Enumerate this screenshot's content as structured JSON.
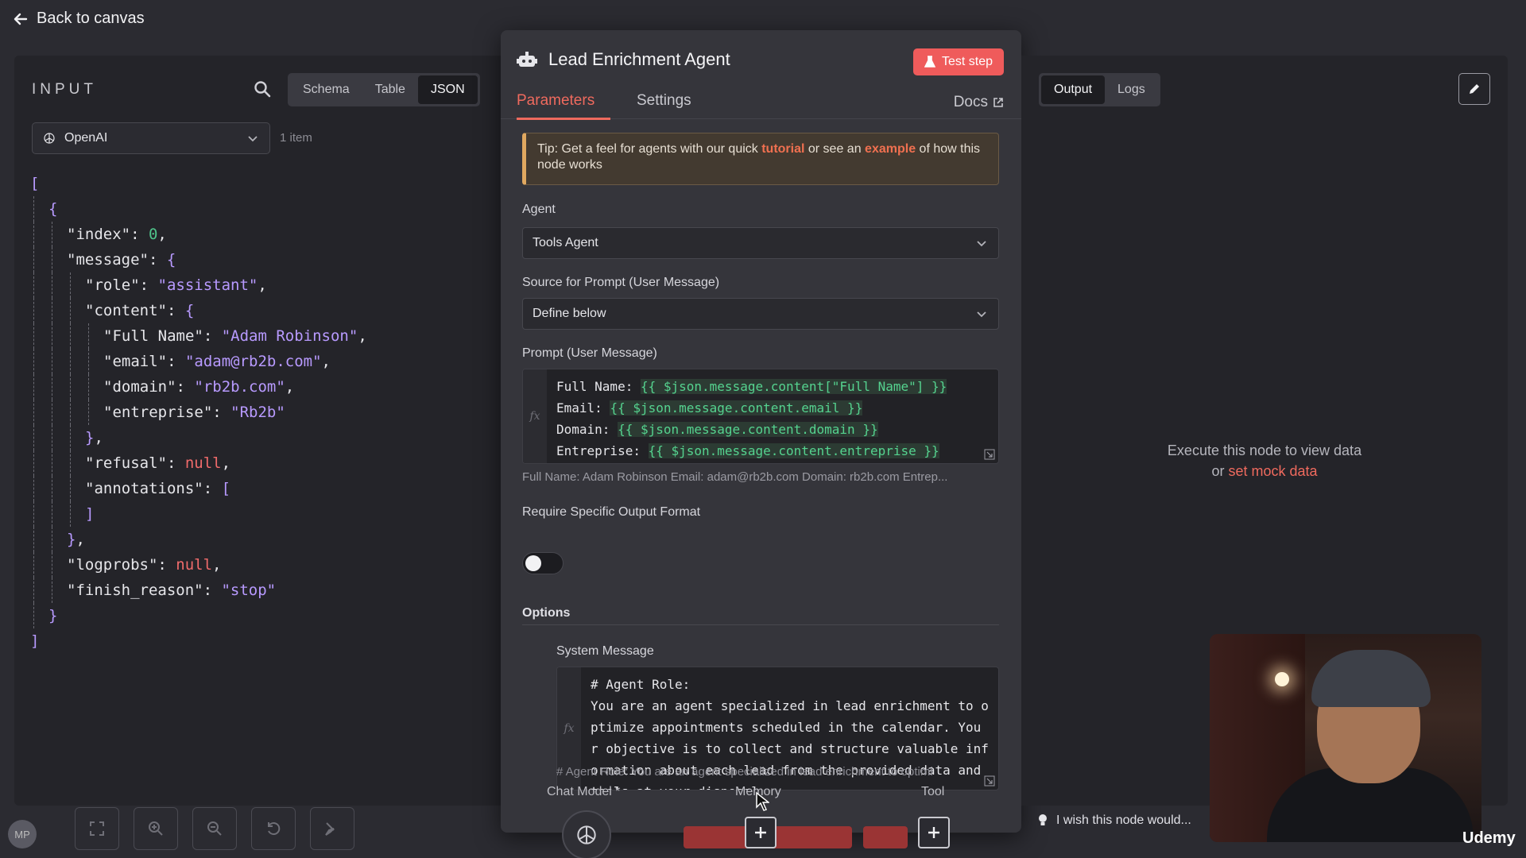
{
  "topbar": {
    "back_label": "Back to canvas"
  },
  "input": {
    "title": "INPUT",
    "views": [
      "Schema",
      "Table",
      "JSON"
    ],
    "active_view": "JSON",
    "source": "OpenAI",
    "item_count": "1 item"
  },
  "node": {
    "title": "Lead Enrichment Agent",
    "test_step": "Test step",
    "tabs": {
      "parameters": "Parameters",
      "settings": "Settings"
    },
    "docs": "Docs",
    "tip": {
      "prefix": "Tip: Get a feel for agents with our quick ",
      "tutorial": "tutorial",
      "middle": " or see an ",
      "example": "example",
      "suffix": " of how this node works"
    },
    "agent_label": "Agent",
    "agent_value": "Tools Agent",
    "source_label": "Source for Prompt (User Message)",
    "source_value": "Define below",
    "prompt_label": "Prompt (User Message)",
    "prompt_lines": [
      {
        "key": "Full Name: ",
        "expr": "{{ $json.message.content[\"Full Name\"] }}"
      },
      {
        "key": "Email: ",
        "expr": "{{ $json.message.content.email }}"
      },
      {
        "key": "Domain: ",
        "expr": "{{ $json.message.content.domain }}"
      },
      {
        "key": "Entreprise: ",
        "expr": "{{ $json.message.content.entreprise }}"
      }
    ],
    "prompt_preview": "Full Name: Adam Robinson Email: adam@rb2b.com Domain: rb2b.com Entrep...",
    "output_format_label": "Require Specific Output Format",
    "options_title": "Options",
    "system_message_label": "System Message",
    "system_lines": [
      "# Agent Role:",
      "You are an agent specialized in lead enrichment to o",
      "ptimize appointments scheduled in the calendar. You",
      "r objective is to collect and structure valuable inf",
      "ormation about each lead from the provided data and",
      "tools at your disposal"
    ],
    "system_preview": "# Agent Role: You are an agent specialized in lead enrichment to optimi",
    "connectors": {
      "chat_model": "Chat Model *",
      "memory": "Memory",
      "tool": "Tool"
    }
  },
  "output": {
    "views": [
      "Output",
      "Logs"
    ],
    "active_view": "Output",
    "message_line1": "Execute this node to view data",
    "message_or": "or ",
    "mock_link": "set mock data"
  },
  "feedback": "I wish this node would...",
  "avatar_initials": "MP",
  "watermark": "Udemy",
  "json_lines": [
    {
      "i": 0,
      "parts": [
        [
          "b",
          "["
        ]
      ]
    },
    {
      "i": 1,
      "parts": [
        [
          "b",
          "{"
        ]
      ]
    },
    {
      "i": 2,
      "parts": [
        [
          "k",
          "\"index\": "
        ],
        [
          "n",
          "0"
        ],
        [
          "k",
          ","
        ]
      ]
    },
    {
      "i": 2,
      "parts": [
        [
          "k",
          "\"message\": "
        ],
        [
          "b",
          "{"
        ]
      ]
    },
    {
      "i": 3,
      "parts": [
        [
          "k",
          "\"role\": "
        ],
        [
          "s",
          "\"assistant\""
        ],
        [
          "k",
          ","
        ]
      ]
    },
    {
      "i": 3,
      "parts": [
        [
          "k",
          "\"content\": "
        ],
        [
          "b",
          "{"
        ]
      ]
    },
    {
      "i": 4,
      "parts": [
        [
          "k",
          "\"Full Name\": "
        ],
        [
          "s",
          "\"Adam Robinson\""
        ],
        [
          "k",
          ","
        ]
      ]
    },
    {
      "i": 4,
      "parts": [
        [
          "k",
          "\"email\": "
        ],
        [
          "s",
          "\"adam@rb2b.com\""
        ],
        [
          "k",
          ","
        ]
      ]
    },
    {
      "i": 4,
      "parts": [
        [
          "k",
          "\"domain\": "
        ],
        [
          "s",
          "\"rb2b.com\""
        ],
        [
          "k",
          ","
        ]
      ]
    },
    {
      "i": 4,
      "parts": [
        [
          "k",
          "\"entreprise\": "
        ],
        [
          "s",
          "\"Rb2b\""
        ]
      ]
    },
    {
      "i": 3,
      "parts": [
        [
          "b",
          "}"
        ],
        [
          "k",
          ","
        ]
      ]
    },
    {
      "i": 3,
      "parts": [
        [
          "k",
          "\"refusal\": "
        ],
        [
          "x",
          "null"
        ],
        [
          "k",
          ","
        ]
      ]
    },
    {
      "i": 3,
      "parts": [
        [
          "k",
          "\"annotations\": "
        ],
        [
          "b",
          "["
        ]
      ]
    },
    {
      "i": 3,
      "parts": [
        [
          "b",
          "]"
        ]
      ]
    },
    {
      "i": 2,
      "parts": [
        [
          "b",
          "}"
        ],
        [
          "k",
          ","
        ]
      ]
    },
    {
      "i": 2,
      "parts": [
        [
          "k",
          "\"logprobs\": "
        ],
        [
          "x",
          "null"
        ],
        [
          "k",
          ","
        ]
      ]
    },
    {
      "i": 2,
      "parts": [
        [
          "k",
          "\"finish_reason\": "
        ],
        [
          "s",
          "\"stop\""
        ]
      ]
    },
    {
      "i": 1,
      "parts": [
        [
          "b",
          "}"
        ]
      ]
    },
    {
      "i": 0,
      "parts": [
        [
          "b",
          "]"
        ]
      ]
    }
  ]
}
